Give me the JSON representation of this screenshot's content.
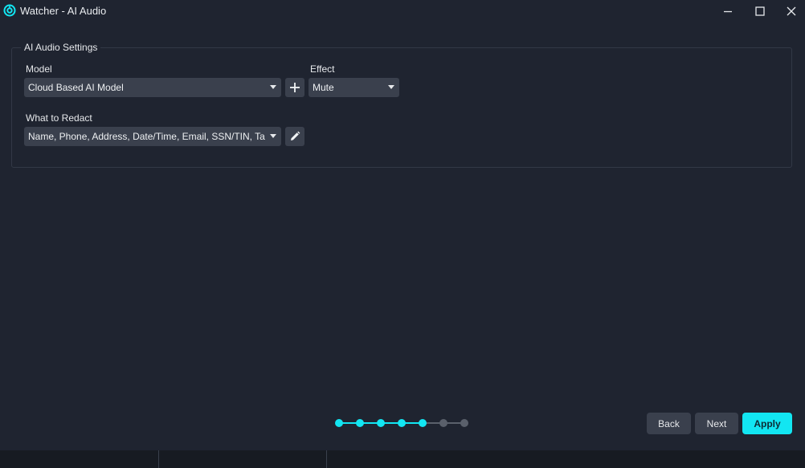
{
  "window": {
    "title": "Watcher - AI Audio",
    "accent_color": "#12e6f2",
    "icons": {
      "app": "watcher-logo-icon",
      "minimize": "minimize-icon",
      "maximize": "maximize-icon",
      "close": "close-icon"
    }
  },
  "settings": {
    "group_title": "AI Audio Settings",
    "model": {
      "label": "Model",
      "value": "Cloud Based AI Model",
      "add_icon": "plus-icon"
    },
    "effect": {
      "label": "Effect",
      "value": "Mute"
    },
    "redact": {
      "label": "What to Redact",
      "value": "Name, Phone, Address, Date/Time, Email, SSN/TIN, Taxpayer",
      "edit_icon": "pencil-icon"
    }
  },
  "wizard": {
    "total_steps": 7,
    "completed_steps": 5,
    "active_color": "#12e6f2",
    "inactive_color": "#5a606b"
  },
  "footer": {
    "back_label": "Back",
    "next_label": "Next",
    "apply_label": "Apply"
  }
}
